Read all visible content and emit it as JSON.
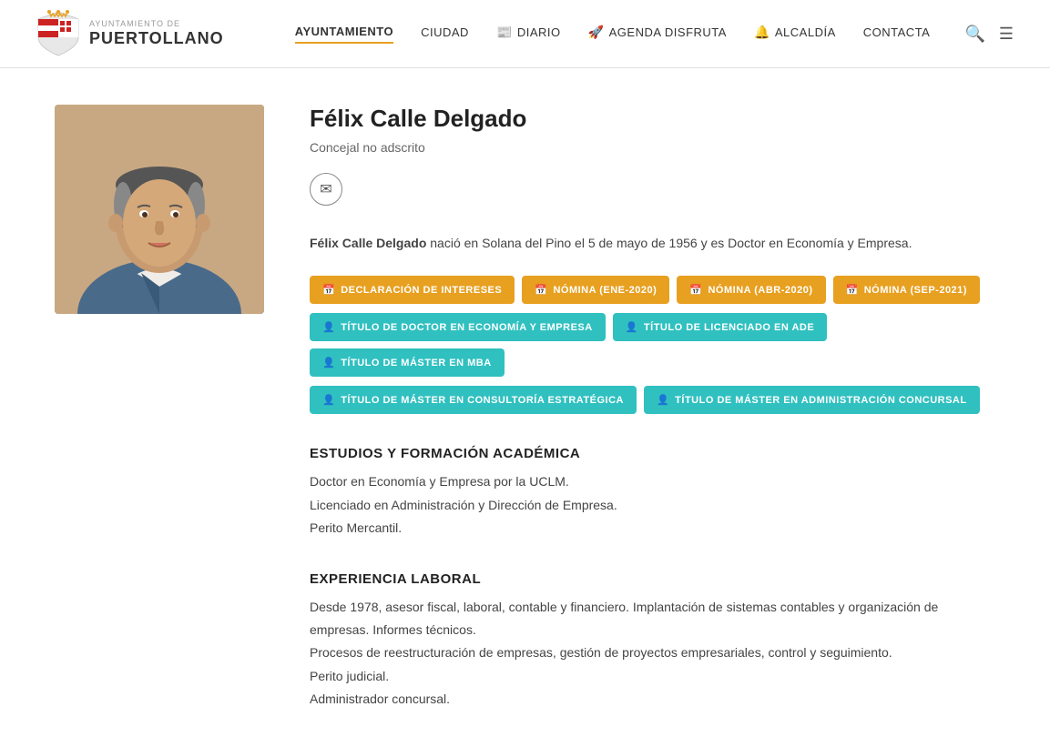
{
  "header": {
    "logo": {
      "subtitle": "AYUNTAMIENTO DE",
      "title": "PUERTOLLANO"
    },
    "nav": {
      "items": [
        {
          "label": "AYUNTAMIENTO",
          "active": true,
          "icon": ""
        },
        {
          "label": "CIUDAD",
          "active": false,
          "icon": ""
        },
        {
          "label": "DIARIO",
          "active": false,
          "icon": "📰"
        },
        {
          "label": "AGENDA DISFRUTA",
          "active": false,
          "icon": "🚀"
        },
        {
          "label": "ALCALDÍA",
          "active": false,
          "icon": "🔔"
        },
        {
          "label": "CONTACTA",
          "active": false,
          "icon": ""
        }
      ]
    }
  },
  "profile": {
    "name": "Félix Calle Delgado",
    "role": "Concejal no adscrito",
    "bio_strong": "Félix Calle Delgado",
    "bio_text": " nació en Solana del Pino el 5 de mayo de 1956 y es Doctor en Economía y Empresa.",
    "email_tooltip": "Email"
  },
  "buttons": {
    "row1": [
      {
        "label": "DECLARACIÓN DE INTERESES",
        "type": "orange",
        "icon": "📅"
      },
      {
        "label": "NÓMINA (ene-2020)",
        "type": "orange",
        "icon": "📅"
      },
      {
        "label": "NÓMINA (abr-2020)",
        "type": "orange",
        "icon": "📅"
      },
      {
        "label": "NÓMINA (sep-2021)",
        "type": "orange",
        "icon": "📅"
      }
    ],
    "row2": [
      {
        "label": "TÍTULO DE DOCTOR EN ECONOMÍA Y EMPRESA",
        "type": "teal",
        "icon": "👤"
      },
      {
        "label": "TÍTULO DE LICENCIADO EN ADE",
        "type": "teal",
        "icon": "👤"
      },
      {
        "label": "TÍTULO DE MÁSTER EN MBA",
        "type": "teal",
        "icon": "👤"
      }
    ],
    "row3": [
      {
        "label": "TÍTULO DE MÁSTER EN CONSULTORÍA ESTRATÉGICA",
        "type": "teal",
        "icon": "👤"
      },
      {
        "label": "TÍTULO DE MÁSTER EN ADMINISTRACIÓN CONCURSAL",
        "type": "teal",
        "icon": "👤"
      }
    ]
  },
  "sections": [
    {
      "title": "ESTUDIOS Y FORMACIÓN ACADÉMICA",
      "lines": [
        "Doctor en Economía y Empresa por la UCLM.",
        "Licenciado en Administración y Dirección de Empresa.",
        "Perito Mercantil."
      ]
    },
    {
      "title": "EXPERIENCIA LABORAL",
      "lines": [
        "Desde 1978, asesor fiscal, laboral, contable y financiero. Implantación de sistemas contables y organización de empresas. Informes técnicos.",
        "Procesos de reestructuración de empresas, gestión de proyectos empresariales, control y seguimiento.",
        "Perito judicial.",
        "Administrador concursal."
      ]
    }
  ]
}
